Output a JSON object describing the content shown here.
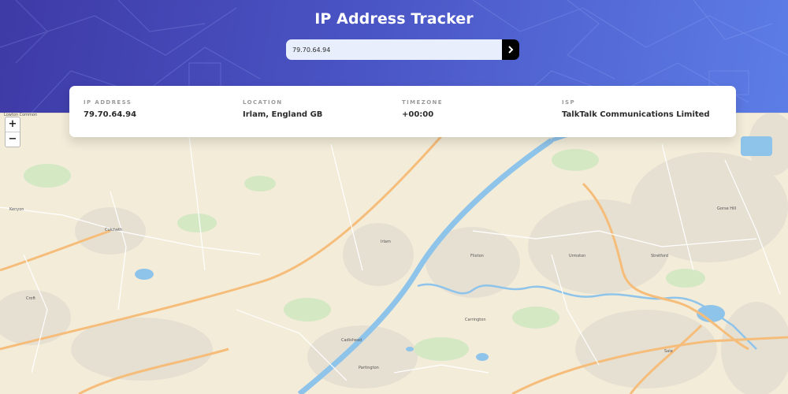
{
  "header": {
    "title": "IP Address Tracker",
    "search": {
      "value": "79.70.64.94",
      "submit_icon": "chevron-right-icon"
    }
  },
  "info": [
    {
      "label": "IP ADDRESS",
      "value": "79.70.64.94"
    },
    {
      "label": "LOCATION",
      "value": "Irlam, England GB"
    },
    {
      "label": "TIMEZONE",
      "value": "+00:00"
    },
    {
      "label": "ISP",
      "value": "TalkTalk Communications Limited"
    }
  ],
  "map": {
    "zoom_in_label": "+",
    "zoom_out_label": "−",
    "place_labels": {
      "lowton": "Lowton Common",
      "kenyon": "Kenyon",
      "culcheth": "Culcheth",
      "croft": "Croft",
      "irlam": "Irlam",
      "flixton": "Flixton",
      "urmston": "Urmston",
      "stretford": "Stretford",
      "carrington": "Carrington",
      "cadishead": "Cadishead",
      "partington": "Partington",
      "sale": "Sale",
      "gorse_hill": "Gorse Hill"
    }
  },
  "colors": {
    "header_gradient_start": "#3e3aa6",
    "header_gradient_end": "#5d7de6",
    "map_land": "#f3ecd9",
    "map_water": "#8fc4ea",
    "map_road": "#f6bd7a"
  }
}
